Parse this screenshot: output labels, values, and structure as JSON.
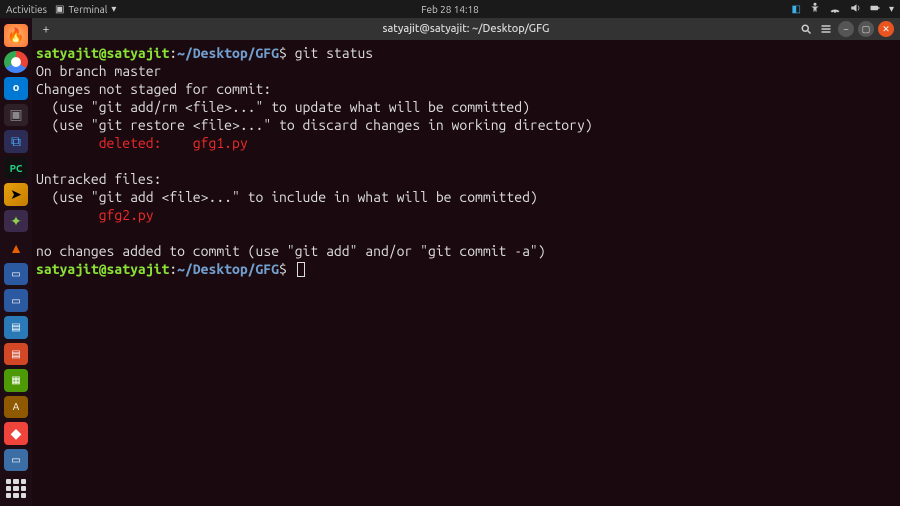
{
  "topbar": {
    "activities": "Activities",
    "app_name": "Terminal",
    "clock": "Feb 28  14:18"
  },
  "dock": {
    "items": [
      {
        "name": "firefox",
        "bg": "#ff7139",
        "glyph": "🦊"
      },
      {
        "name": "chrome",
        "bg": "#fff",
        "glyph": "◉"
      },
      {
        "name": "outlook",
        "bg": "#0078d4",
        "glyph": "✉"
      },
      {
        "name": "terminal",
        "bg": "#2c2c2c",
        "glyph": "▢",
        "active": true
      },
      {
        "name": "vscode",
        "bg": "#2b2b40",
        "glyph": "⧉"
      },
      {
        "name": "pycharm",
        "bg": "#111",
        "glyph": "◆"
      },
      {
        "name": "plex",
        "bg": "#e5a00d",
        "glyph": "➤"
      },
      {
        "name": "spotify",
        "bg": "#1db954",
        "glyph": "●"
      },
      {
        "name": "vlc",
        "bg": "#e85e00",
        "glyph": "▲"
      },
      {
        "name": "folder1",
        "bg": "#2c5aa0",
        "glyph": "▭"
      },
      {
        "name": "folder2",
        "bg": "#2c5aa0",
        "glyph": "▭"
      },
      {
        "name": "writer",
        "bg": "#2b7ab8",
        "glyph": "▤"
      },
      {
        "name": "impress",
        "bg": "#d24726",
        "glyph": "▤"
      },
      {
        "name": "updater",
        "bg": "#4e9a06",
        "glyph": "⟳"
      },
      {
        "name": "amazon",
        "bg": "#ff9900",
        "glyph": "a"
      },
      {
        "name": "anydesk",
        "bg": "#ef443b",
        "glyph": "◆"
      },
      {
        "name": "files",
        "bg": "#2c5aa0",
        "glyph": "▭"
      }
    ]
  },
  "window": {
    "title": "satyajit@satyajit: ~/Desktop/GFG",
    "new_tab": "+"
  },
  "terminal": {
    "prompt_user": "satyajit@satyajit",
    "prompt_colon": ":",
    "prompt_path": "~/Desktop/GFG",
    "prompt_dollar": "$",
    "command": "git status",
    "lines": {
      "l1": "On branch master",
      "l2": "Changes not staged for commit:",
      "l3": "  (use \"git add/rm <file>...\" to update what will be committed)",
      "l4": "  (use \"git restore <file>...\" to discard changes in working directory)",
      "l5_label": "        deleted:    ",
      "l5_file": "gfg1.py",
      "l6": "Untracked files:",
      "l7": "  (use \"git add <file>...\" to include in what will be committed)",
      "l8_file": "        gfg2.py",
      "l9": "no changes added to commit (use \"git add\" and/or \"git commit -a\")"
    }
  }
}
